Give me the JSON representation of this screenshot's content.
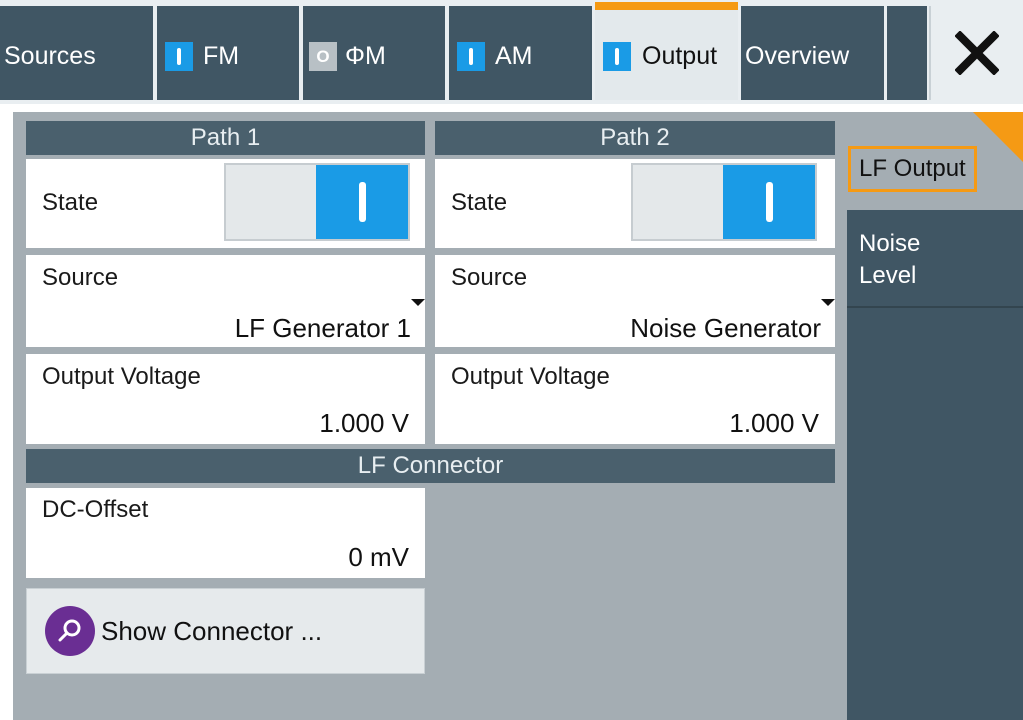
{
  "tabs": [
    {
      "label": "Sources"
    },
    {
      "label": "FM",
      "indicator": "on"
    },
    {
      "label": "ΦM",
      "indicator": "off",
      "indicator_text": "O"
    },
    {
      "label": "AM",
      "indicator": "on"
    },
    {
      "label": "Output",
      "indicator": "on",
      "active": true
    },
    {
      "label": "Overview"
    }
  ],
  "close_icon": "close-x-icon",
  "path1": {
    "header": "Path 1",
    "state_label": "State",
    "state_on": true,
    "source_label": "Source",
    "source_value": "LF Generator 1",
    "voltage_label": "Output Voltage",
    "voltage_value": "1.000 V"
  },
  "path2": {
    "header": "Path 2",
    "state_label": "State",
    "state_on": true,
    "source_label": "Source",
    "source_value": "Noise Generator",
    "voltage_label": "Output Voltage",
    "voltage_value": "1.000 V"
  },
  "connector": {
    "header": "LF Connector",
    "dc_offset_label": "DC-Offset",
    "dc_offset_value": "0 mV",
    "show_button_label": "Show Connector ...",
    "show_button_icon": "search-icon"
  },
  "side_nav": {
    "active_label": "LF Output",
    "items": [
      {
        "line1": "Noise",
        "line2": "Level"
      }
    ]
  },
  "colors": {
    "accent": "#f59a14",
    "toggle_on": "#1a9be6",
    "header_bg": "#4a606d",
    "nav_bg": "#405664",
    "button_icon": "#6a2e93"
  }
}
